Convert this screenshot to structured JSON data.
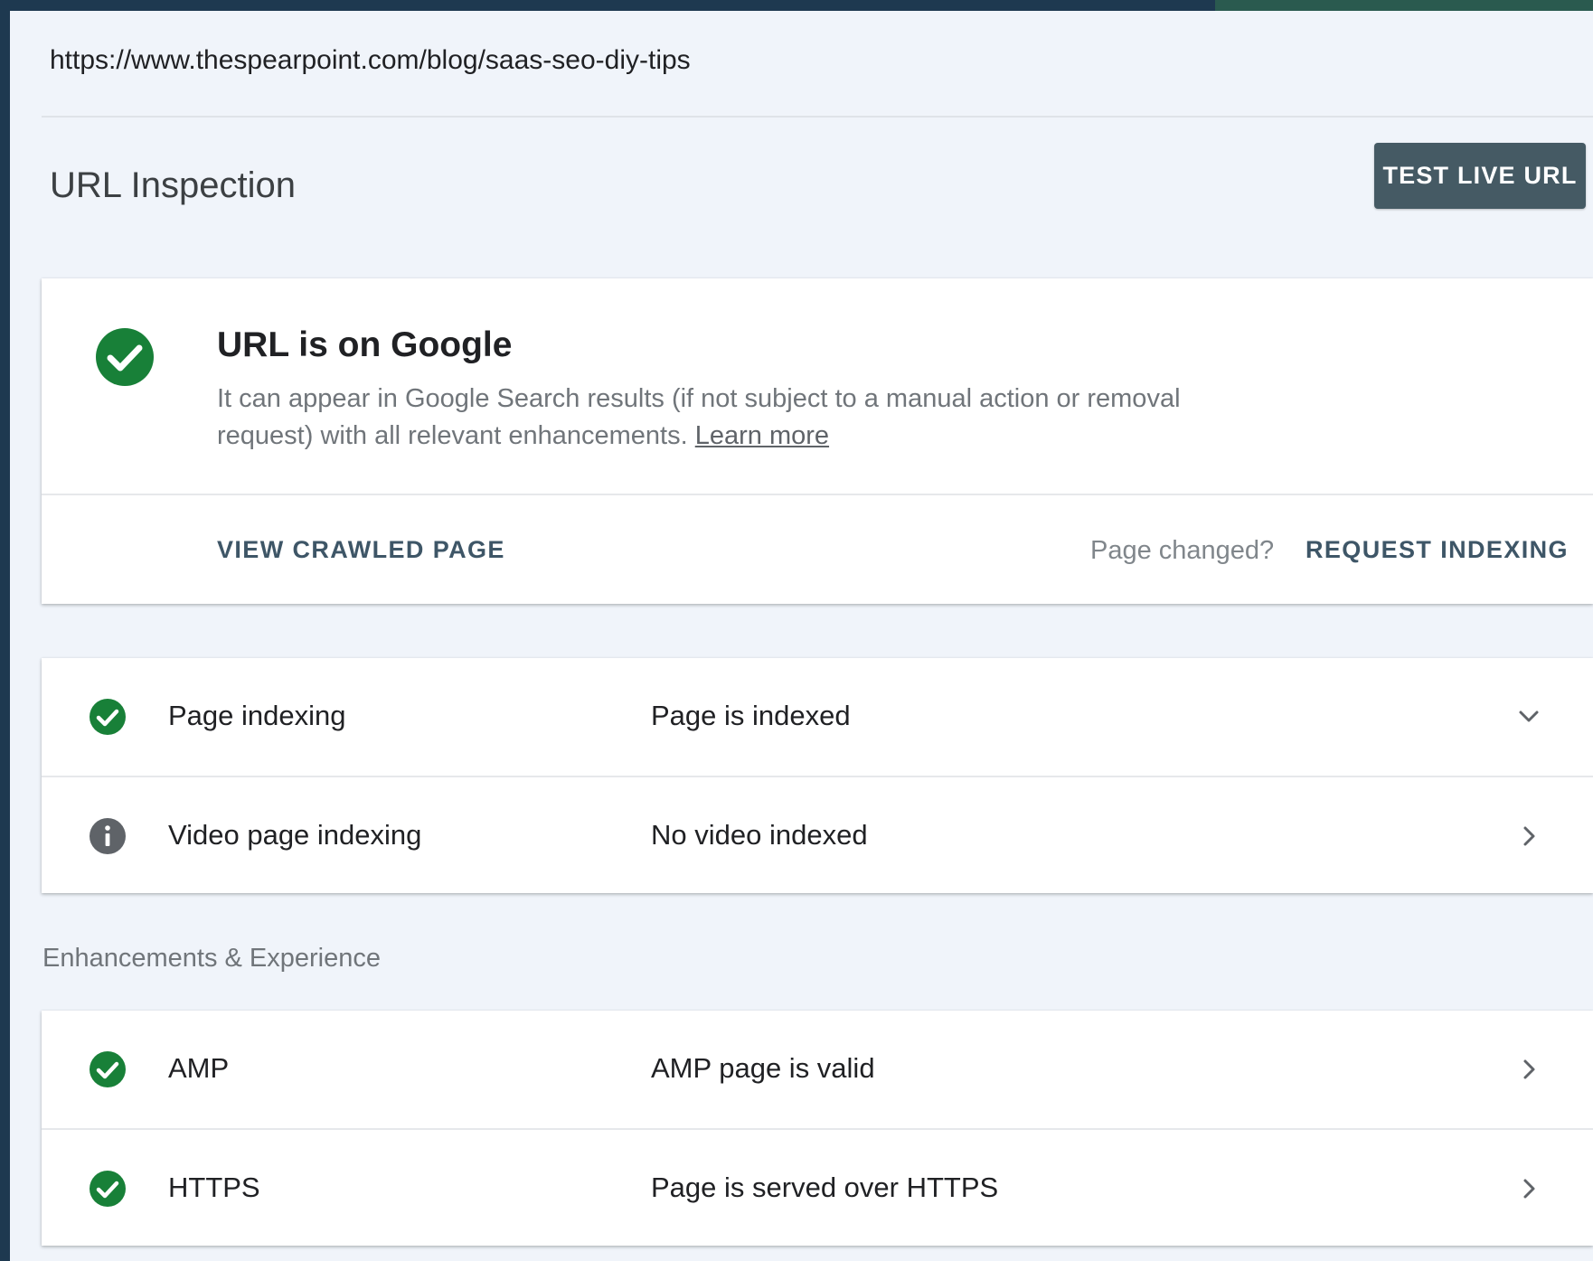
{
  "colors": {
    "success": "#188038",
    "info": "#5f6368",
    "primary_button": "#455a64",
    "link_text": "#3e5667"
  },
  "url_bar": {
    "url": "https://www.thespearpoint.com/blog/saas-seo-diy-tips"
  },
  "header": {
    "title": "URL Inspection",
    "test_live_url_label": "TEST LIVE URL"
  },
  "status": {
    "icon": "check-circle-icon",
    "title": "URL is on Google",
    "description": "It can appear in Google Search results (if not subject to a manual action or removal request) with all relevant enhancements.",
    "learn_more": "Learn more",
    "view_crawled_label": "VIEW CRAWLED PAGE",
    "page_changed_label": "Page changed?",
    "request_indexing_label": "REQUEST INDEXING"
  },
  "indexing_rows": [
    {
      "icon": "check-circle-icon",
      "label": "Page indexing",
      "value": "Page is indexed",
      "chevron": "chevron-down-icon"
    },
    {
      "icon": "info-icon",
      "label": "Video page indexing",
      "value": "No video indexed",
      "chevron": "chevron-right-icon"
    }
  ],
  "enhancements": {
    "section_label": "Enhancements & Experience",
    "rows": [
      {
        "icon": "check-circle-icon",
        "label": "AMP",
        "value": "AMP page is valid",
        "chevron": "chevron-right-icon"
      },
      {
        "icon": "check-circle-icon",
        "label": "HTTPS",
        "value": "Page is served over HTTPS",
        "chevron": "chevron-right-icon"
      }
    ]
  }
}
